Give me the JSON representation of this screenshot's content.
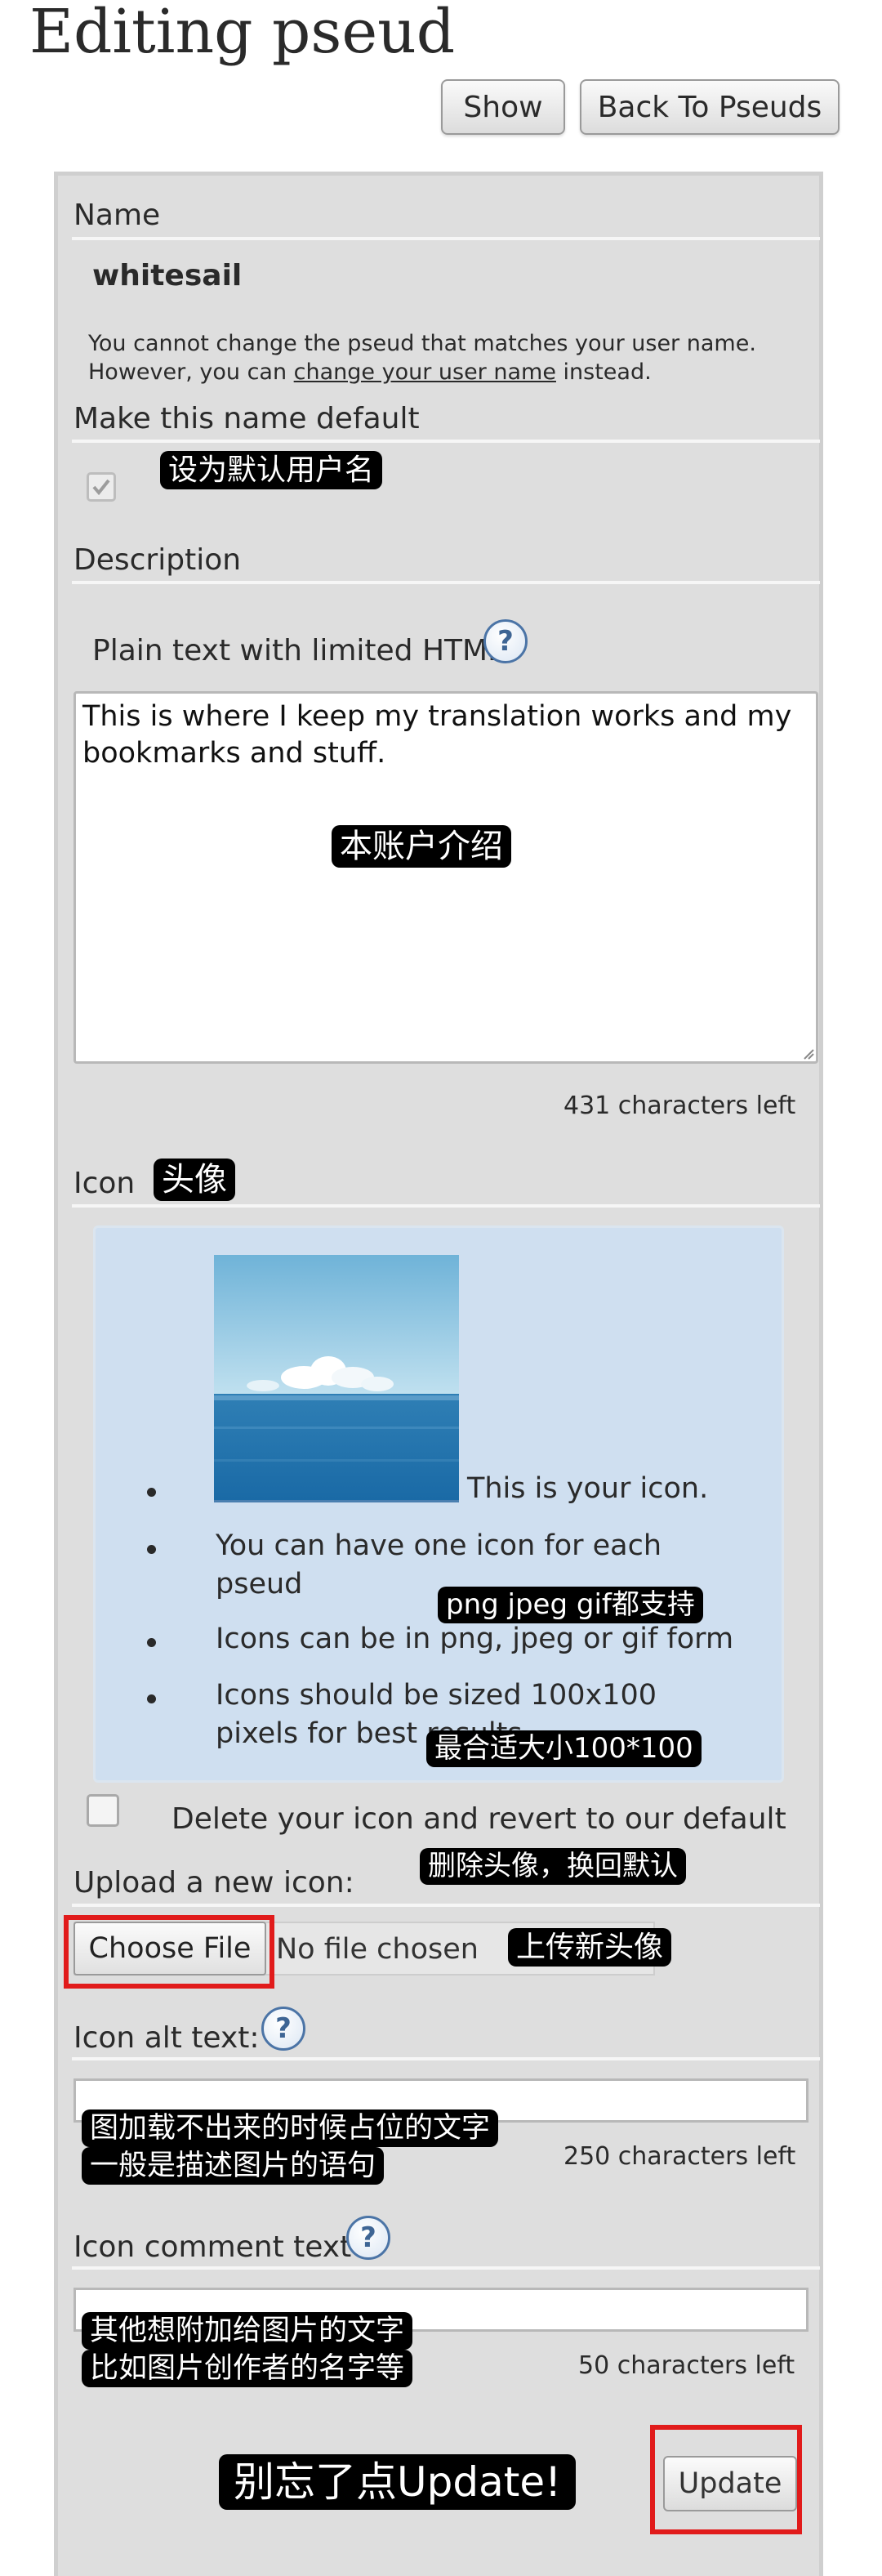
{
  "header": {
    "title": "Editing pseud",
    "show_label": "Show",
    "back_label": "Back To Pseuds"
  },
  "name_section": {
    "label": "Name",
    "pseud": "whitesail",
    "note_line1": "You cannot change the pseud that matches your user name.",
    "note_line2_prefix": "However, you can ",
    "note_link": "change your user name",
    "note_line2_suffix": " instead."
  },
  "default_section": {
    "label": "Make this name default",
    "checked": true,
    "annotation": "设为默认用户名"
  },
  "description_section": {
    "label": "Description",
    "hint": "Plain text with limited HTML",
    "value_line1": "This is where I keep my translation works and my",
    "value_line2": "bookmarks and stuff.",
    "annotation": "本账户介绍",
    "chars_left": "431 characters left"
  },
  "icon_section": {
    "label": "Icon",
    "label_annotation": "头像",
    "items": [
      "This is your icon.",
      "You can have one icon for each",
      "pseud",
      "Icons can be in png, jpeg or gif form",
      "Icons should be sized 100x100",
      "pixels for best results"
    ],
    "format_annotation": "png jpeg gif都支持",
    "size_annotation": "最合适大小100*100",
    "delete_label": "Delete your icon and revert to our default",
    "delete_annotation": "删除头像，换回默认",
    "upload_label": "Upload a new icon:",
    "choose_file_label": "Choose File",
    "no_file_text": "No file chosen",
    "upload_annotation": "上传新头像"
  },
  "alt_section": {
    "label": "Icon alt text:",
    "value": "",
    "annotation_line1": "图加载不出来的时候占位的文字",
    "annotation_line2": "一般是描述图片的语句",
    "chars_left": "250 characters left"
  },
  "comment_section": {
    "label": "Icon comment text",
    "value": "",
    "annotation_line1": "其他想附加给图片的文字",
    "annotation_line2": "比如图片创作者的名字等",
    "chars_left": "50 characters left"
  },
  "footer": {
    "update_annotation": "别忘了点Update!",
    "update_label": "Update"
  },
  "colors": {
    "panel_bg": "#dedede",
    "icon_box_bg": "#cfdff0",
    "highlight_red": "#e11b1b",
    "overlay_bg": "#000000",
    "help_icon_blue": "#4b74a6"
  }
}
